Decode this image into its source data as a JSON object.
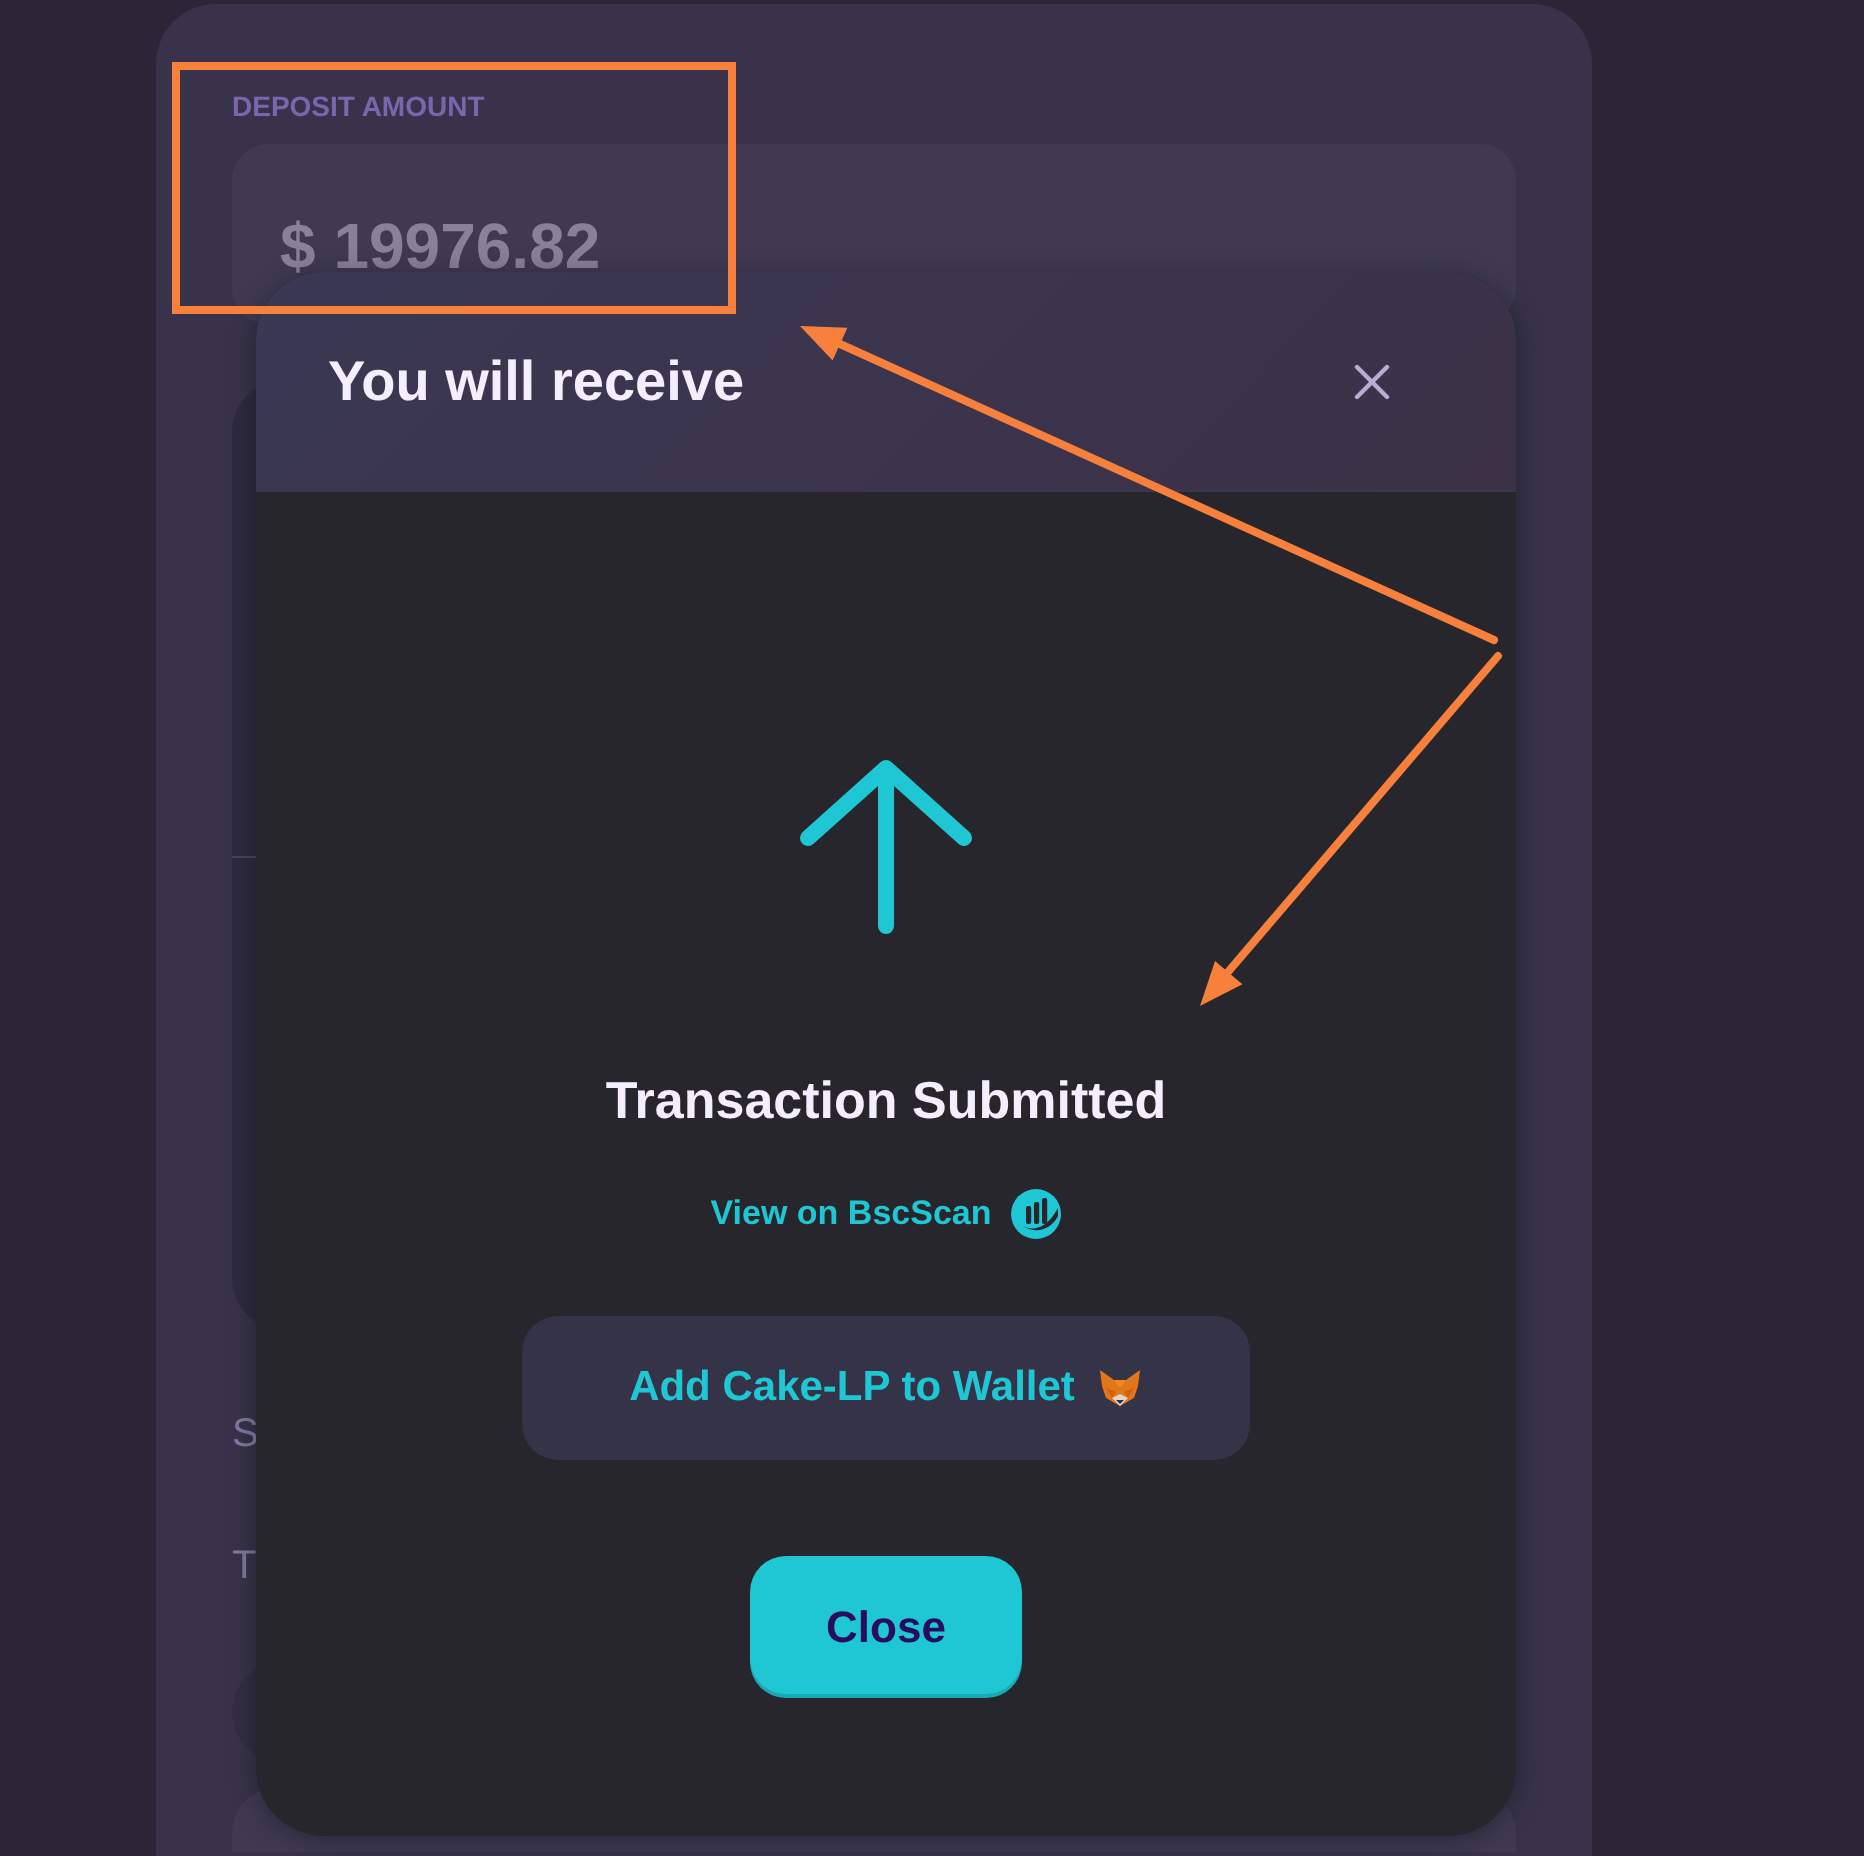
{
  "deposit": {
    "label": "DEPOSIT AMOUNT",
    "value": "$ 19976.82"
  },
  "background_letters": [
    "S",
    "T"
  ],
  "modal": {
    "title": "You will receive",
    "status": "Transaction Submitted",
    "link": "View on BscScan",
    "add_token_button": "Add Cake-LP to Wallet",
    "close_button": "Close"
  }
}
